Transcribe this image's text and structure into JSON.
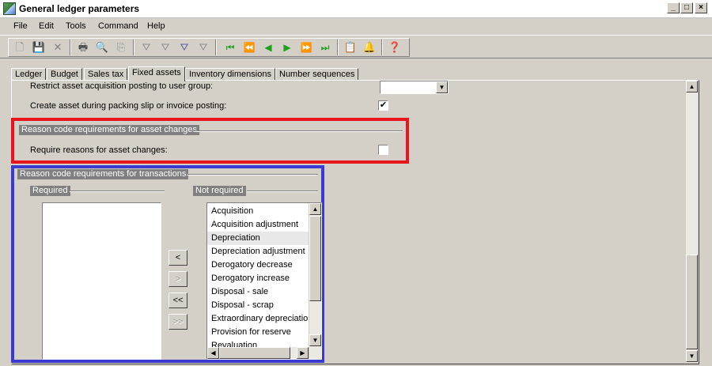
{
  "window": {
    "title": "General ledger parameters"
  },
  "menu": {
    "items": [
      "File",
      "Edit",
      "Tools",
      "Command",
      "Help"
    ]
  },
  "tabs": [
    {
      "label": "Ledger"
    },
    {
      "label": "Budget"
    },
    {
      "label": "Sales tax"
    },
    {
      "label": "Fixed assets"
    },
    {
      "label": "Inventory dimensions"
    },
    {
      "label": "Number sequences"
    }
  ],
  "active_tab": "Fixed assets",
  "fields": {
    "restrict_label": "Restrict asset acquisition posting to user group:",
    "restrict_value": "",
    "create_label": "Create asset during packing slip or invoice posting:",
    "create_checked": true
  },
  "asset_changes_group": {
    "title": "Reason code requirements for asset changes",
    "require_label": "Require reasons for asset changes:",
    "require_checked": false
  },
  "transactions_group": {
    "title": "Reason code requirements for transactions",
    "required_label": "Required",
    "not_required_label": "Not required",
    "required_items": [],
    "not_required_items": [
      "Acquisition",
      "Acquisition adjustment",
      "Depreciation",
      "Depreciation adjustment",
      "Derogatory decrease",
      "Derogatory increase",
      "Disposal - sale",
      "Disposal - scrap",
      "Extraordinary depreciation",
      "Provision for reserve",
      "Revaluation"
    ],
    "selected_item": "Depreciation",
    "move_buttons": {
      "move_left": "<",
      "move_right": ">",
      "move_all_left": "<<",
      "move_all_right": ">>"
    }
  },
  "highlight_colors": {
    "red": "#e8151f",
    "blue": "#3b3bd2"
  }
}
